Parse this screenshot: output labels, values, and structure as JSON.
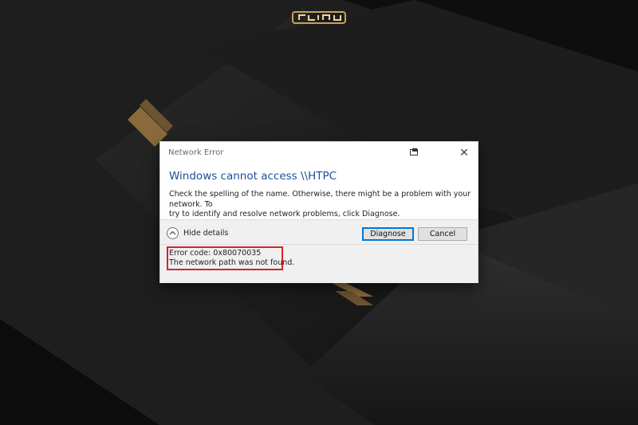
{
  "logo": {
    "text": "گجت نیوز"
  },
  "dialog": {
    "window_title": "Network Error",
    "heading": "Windows cannot access \\\\HTPC",
    "body_line1": "Check the spelling of the name. Otherwise, there might be a problem with your network. To",
    "body_line2": "try to identify and resolve network problems, click Diagnose.",
    "hide_details_label": "Hide details",
    "diagnose_label": "Diagnose",
    "cancel_label": "Cancel",
    "close_glyph": "✕",
    "error_code": "Error code: 0x80070035",
    "error_message": "The network path was not found."
  },
  "colors": {
    "heading": "#1c4f9c",
    "highlight_border": "#d2232a",
    "background": "#141414",
    "accent_stripe": "#8a6a3a"
  },
  "icons": [
    "snip-icon",
    "close-icon",
    "chevron-up-icon"
  ]
}
